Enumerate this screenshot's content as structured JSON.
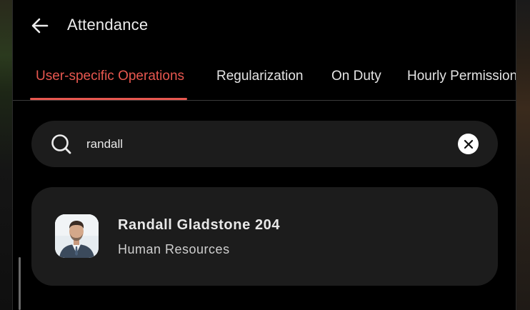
{
  "header": {
    "title": "Attendance",
    "back_icon": "arrow-left-icon"
  },
  "tabs": [
    {
      "label": "User-specific Operations",
      "active": true
    },
    {
      "label": "Regularization",
      "active": false
    },
    {
      "label": "On Duty",
      "active": false
    },
    {
      "label": "Hourly Permission",
      "active": false
    }
  ],
  "search": {
    "value": "randall",
    "icon": "search-icon",
    "clear_icon": "close-icon"
  },
  "results": [
    {
      "name": "Randall Gladstone 204",
      "department": "Human Resources",
      "avatar": "avatar"
    }
  ],
  "colors": {
    "accent": "#e8574f",
    "background": "#000000",
    "card": "#1c1c1c"
  }
}
